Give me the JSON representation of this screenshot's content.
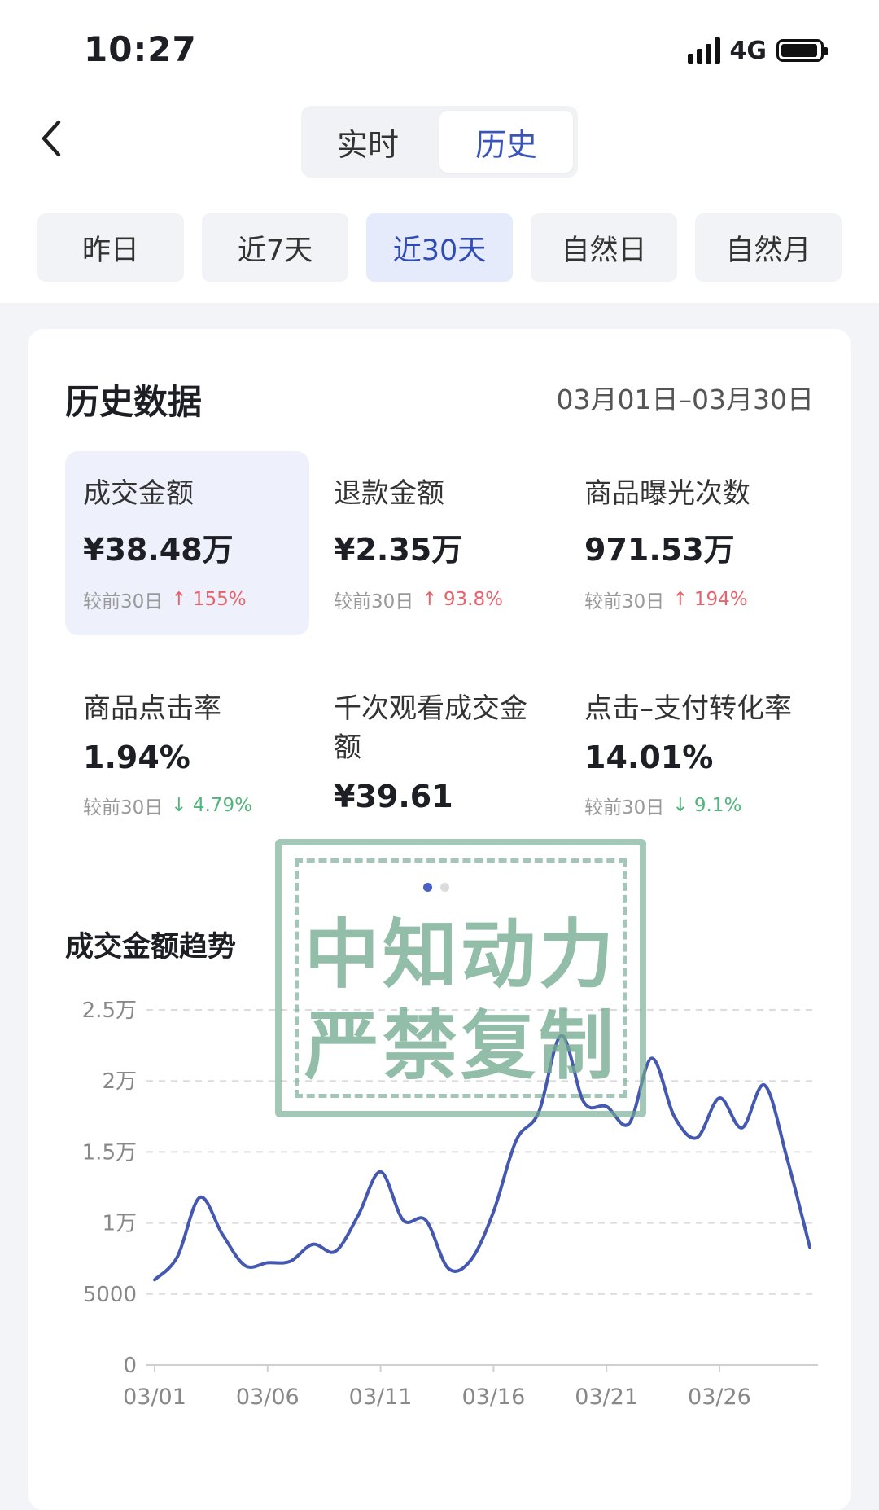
{
  "status_bar": {
    "time": "10:27",
    "network": "4G"
  },
  "nav": {
    "tabs": [
      "实时",
      "历史"
    ],
    "active_tab": "历史"
  },
  "date_ranges": [
    "昨日",
    "近7天",
    "近30天",
    "自然日",
    "自然月"
  ],
  "active_range": "近30天",
  "history": {
    "title": "历史数据",
    "date_range": "03月01日–03月30日",
    "metrics": [
      {
        "label": "成交金额",
        "value": "¥38.48万",
        "compare": "较前30日",
        "delta": "↑ 155%",
        "direction": "up"
      },
      {
        "label": "退款金额",
        "value": "¥2.35万",
        "compare": "较前30日",
        "delta": "↑ 93.8%",
        "direction": "up"
      },
      {
        "label": "商品曝光次数",
        "value": "971.53万",
        "compare": "较前30日",
        "delta": "↑ 194%",
        "direction": "up"
      },
      {
        "label": "商品点击率",
        "value": "1.94%",
        "compare": "较前30日",
        "delta": "↓ 4.79%",
        "direction": "down"
      },
      {
        "label": "千次观看成交金额",
        "value": "¥39.61",
        "compare": "",
        "delta": "",
        "direction": ""
      },
      {
        "label": "点击–支付转化率",
        "value": "14.01%",
        "compare": "较前30日",
        "delta": "↓ 9.1%",
        "direction": "down"
      }
    ]
  },
  "watermark": {
    "line1": "中知动力",
    "line2": "严禁复制"
  },
  "colors": {
    "accent": "#3a55b8",
    "line": "#4558b0",
    "up": "#e5646b",
    "down": "#52b57d"
  },
  "chart_data": {
    "type": "line",
    "title": "成交金额趋势",
    "x": [
      "03/01",
      "03/02",
      "03/03",
      "03/04",
      "03/05",
      "03/06",
      "03/07",
      "03/08",
      "03/09",
      "03/10",
      "03/11",
      "03/12",
      "03/13",
      "03/14",
      "03/15",
      "03/16",
      "03/17",
      "03/18",
      "03/19",
      "03/20",
      "03/21",
      "03/22",
      "03/23",
      "03/24",
      "03/25",
      "03/26",
      "03/27",
      "03/28",
      "03/29",
      "03/30"
    ],
    "xticks": [
      "03/01",
      "03/06",
      "03/11",
      "03/16",
      "03/21",
      "03/26"
    ],
    "series": [
      {
        "values": [
          6000,
          7600,
          11800,
          9200,
          7000,
          7200,
          7300,
          8500,
          8000,
          10500,
          13600,
          10200,
          10200,
          6800,
          7400,
          10800,
          15800,
          17800,
          23200,
          18500,
          18200,
          17000,
          21600,
          17500,
          16000,
          18800,
          16700,
          19700,
          14500,
          8300
        ]
      }
    ],
    "yticks": [
      "0",
      "5000",
      "1万",
      "1.5万",
      "2万",
      "2.5万"
    ],
    "ylim": [
      0,
      25000
    ],
    "grid": true
  }
}
